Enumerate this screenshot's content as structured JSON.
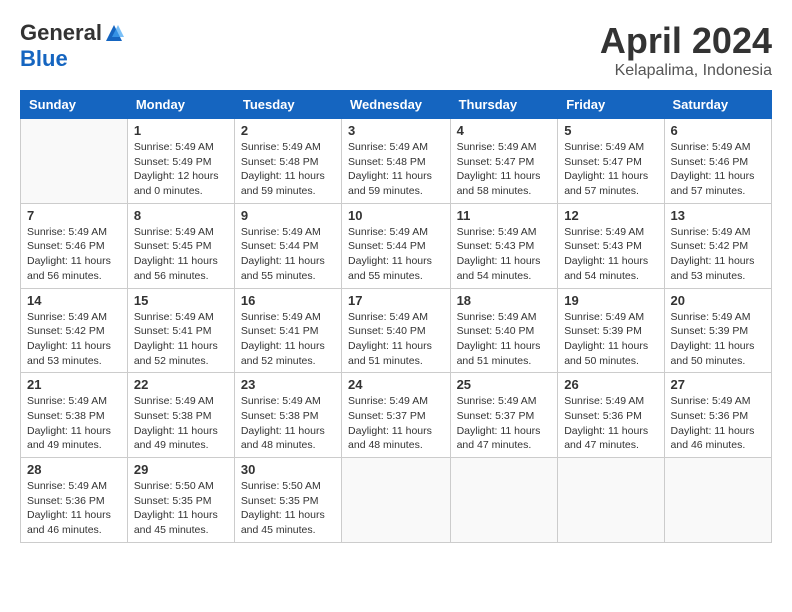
{
  "header": {
    "logo_general": "General",
    "logo_blue": "Blue",
    "month_title": "April 2024",
    "location": "Kelapalima, Indonesia"
  },
  "weekdays": [
    "Sunday",
    "Monday",
    "Tuesday",
    "Wednesday",
    "Thursday",
    "Friday",
    "Saturday"
  ],
  "weeks": [
    [
      {
        "day": "",
        "sunrise": "",
        "sunset": "",
        "daylight": ""
      },
      {
        "day": "1",
        "sunrise": "Sunrise: 5:49 AM",
        "sunset": "Sunset: 5:49 PM",
        "daylight": "Daylight: 12 hours and 0 minutes."
      },
      {
        "day": "2",
        "sunrise": "Sunrise: 5:49 AM",
        "sunset": "Sunset: 5:48 PM",
        "daylight": "Daylight: 11 hours and 59 minutes."
      },
      {
        "day": "3",
        "sunrise": "Sunrise: 5:49 AM",
        "sunset": "Sunset: 5:48 PM",
        "daylight": "Daylight: 11 hours and 59 minutes."
      },
      {
        "day": "4",
        "sunrise": "Sunrise: 5:49 AM",
        "sunset": "Sunset: 5:47 PM",
        "daylight": "Daylight: 11 hours and 58 minutes."
      },
      {
        "day": "5",
        "sunrise": "Sunrise: 5:49 AM",
        "sunset": "Sunset: 5:47 PM",
        "daylight": "Daylight: 11 hours and 57 minutes."
      },
      {
        "day": "6",
        "sunrise": "Sunrise: 5:49 AM",
        "sunset": "Sunset: 5:46 PM",
        "daylight": "Daylight: 11 hours and 57 minutes."
      }
    ],
    [
      {
        "day": "7",
        "sunrise": "Sunrise: 5:49 AM",
        "sunset": "Sunset: 5:46 PM",
        "daylight": "Daylight: 11 hours and 56 minutes."
      },
      {
        "day": "8",
        "sunrise": "Sunrise: 5:49 AM",
        "sunset": "Sunset: 5:45 PM",
        "daylight": "Daylight: 11 hours and 56 minutes."
      },
      {
        "day": "9",
        "sunrise": "Sunrise: 5:49 AM",
        "sunset": "Sunset: 5:44 PM",
        "daylight": "Daylight: 11 hours and 55 minutes."
      },
      {
        "day": "10",
        "sunrise": "Sunrise: 5:49 AM",
        "sunset": "Sunset: 5:44 PM",
        "daylight": "Daylight: 11 hours and 55 minutes."
      },
      {
        "day": "11",
        "sunrise": "Sunrise: 5:49 AM",
        "sunset": "Sunset: 5:43 PM",
        "daylight": "Daylight: 11 hours and 54 minutes."
      },
      {
        "day": "12",
        "sunrise": "Sunrise: 5:49 AM",
        "sunset": "Sunset: 5:43 PM",
        "daylight": "Daylight: 11 hours and 54 minutes."
      },
      {
        "day": "13",
        "sunrise": "Sunrise: 5:49 AM",
        "sunset": "Sunset: 5:42 PM",
        "daylight": "Daylight: 11 hours and 53 minutes."
      }
    ],
    [
      {
        "day": "14",
        "sunrise": "Sunrise: 5:49 AM",
        "sunset": "Sunset: 5:42 PM",
        "daylight": "Daylight: 11 hours and 53 minutes."
      },
      {
        "day": "15",
        "sunrise": "Sunrise: 5:49 AM",
        "sunset": "Sunset: 5:41 PM",
        "daylight": "Daylight: 11 hours and 52 minutes."
      },
      {
        "day": "16",
        "sunrise": "Sunrise: 5:49 AM",
        "sunset": "Sunset: 5:41 PM",
        "daylight": "Daylight: 11 hours and 52 minutes."
      },
      {
        "day": "17",
        "sunrise": "Sunrise: 5:49 AM",
        "sunset": "Sunset: 5:40 PM",
        "daylight": "Daylight: 11 hours and 51 minutes."
      },
      {
        "day": "18",
        "sunrise": "Sunrise: 5:49 AM",
        "sunset": "Sunset: 5:40 PM",
        "daylight": "Daylight: 11 hours and 51 minutes."
      },
      {
        "day": "19",
        "sunrise": "Sunrise: 5:49 AM",
        "sunset": "Sunset: 5:39 PM",
        "daylight": "Daylight: 11 hours and 50 minutes."
      },
      {
        "day": "20",
        "sunrise": "Sunrise: 5:49 AM",
        "sunset": "Sunset: 5:39 PM",
        "daylight": "Daylight: 11 hours and 50 minutes."
      }
    ],
    [
      {
        "day": "21",
        "sunrise": "Sunrise: 5:49 AM",
        "sunset": "Sunset: 5:38 PM",
        "daylight": "Daylight: 11 hours and 49 minutes."
      },
      {
        "day": "22",
        "sunrise": "Sunrise: 5:49 AM",
        "sunset": "Sunset: 5:38 PM",
        "daylight": "Daylight: 11 hours and 49 minutes."
      },
      {
        "day": "23",
        "sunrise": "Sunrise: 5:49 AM",
        "sunset": "Sunset: 5:38 PM",
        "daylight": "Daylight: 11 hours and 48 minutes."
      },
      {
        "day": "24",
        "sunrise": "Sunrise: 5:49 AM",
        "sunset": "Sunset: 5:37 PM",
        "daylight": "Daylight: 11 hours and 48 minutes."
      },
      {
        "day": "25",
        "sunrise": "Sunrise: 5:49 AM",
        "sunset": "Sunset: 5:37 PM",
        "daylight": "Daylight: 11 hours and 47 minutes."
      },
      {
        "day": "26",
        "sunrise": "Sunrise: 5:49 AM",
        "sunset": "Sunset: 5:36 PM",
        "daylight": "Daylight: 11 hours and 47 minutes."
      },
      {
        "day": "27",
        "sunrise": "Sunrise: 5:49 AM",
        "sunset": "Sunset: 5:36 PM",
        "daylight": "Daylight: 11 hours and 46 minutes."
      }
    ],
    [
      {
        "day": "28",
        "sunrise": "Sunrise: 5:49 AM",
        "sunset": "Sunset: 5:36 PM",
        "daylight": "Daylight: 11 hours and 46 minutes."
      },
      {
        "day": "29",
        "sunrise": "Sunrise: 5:50 AM",
        "sunset": "Sunset: 5:35 PM",
        "daylight": "Daylight: 11 hours and 45 minutes."
      },
      {
        "day": "30",
        "sunrise": "Sunrise: 5:50 AM",
        "sunset": "Sunset: 5:35 PM",
        "daylight": "Daylight: 11 hours and 45 minutes."
      },
      {
        "day": "",
        "sunrise": "",
        "sunset": "",
        "daylight": ""
      },
      {
        "day": "",
        "sunrise": "",
        "sunset": "",
        "daylight": ""
      },
      {
        "day": "",
        "sunrise": "",
        "sunset": "",
        "daylight": ""
      },
      {
        "day": "",
        "sunrise": "",
        "sunset": "",
        "daylight": ""
      }
    ]
  ]
}
